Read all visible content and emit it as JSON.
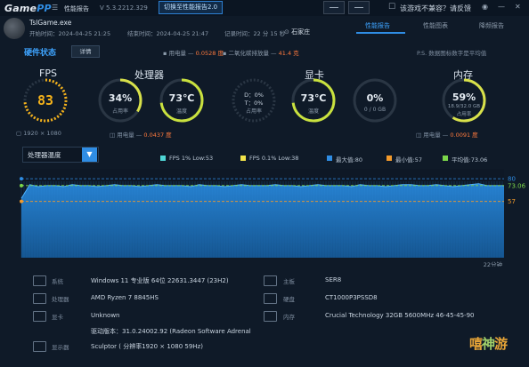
{
  "titlebar": {
    "logo_a": "Game",
    "logo_b": "PP",
    "menu_icon": "menu-icon",
    "report_label": "性能报告",
    "version": "V 5.3.2212.329",
    "switch_label": "切换至性能报告2.0",
    "feedback_label": "该游戏不兼容？请反馈",
    "feedback_icon": "chat-icon"
  },
  "session": {
    "app_name": "TslGame.exe",
    "start_label": "开始时间：",
    "start_time": "2024-04-25 21:25",
    "end_label": "结束时间：",
    "end_time": "2024-04-25 21:47",
    "duration_label": "记录时间：",
    "duration": "22 分 15 秒",
    "location": "石家庄",
    "power_label": "用电量 —",
    "power_value": "0.0528 度",
    "co2_label": "二氧化碳排放量 —",
    "co2_value": "41.4 克"
  },
  "tabs": [
    "性能报告",
    "性能图表",
    "降频报告"
  ],
  "hardware": {
    "title": "硬件状态",
    "detail_btn": "详情",
    "note": "P.S. 数据图标数字是平均值"
  },
  "sections": {
    "fps": {
      "title": "FPS",
      "value": "83",
      "sub": "1920 × 1080",
      "level": 0.75
    },
    "cpu": {
      "title": "处理器",
      "usage_value": "34%",
      "usage_label": "占用率",
      "usage_level": 0.34,
      "temp_value": "73℃",
      "temp_label": "温度",
      "temp_level": 0.73,
      "power_label": "用电量 —",
      "power_value": "0.0437 度"
    },
    "gpu": {
      "title": "显卡",
      "usage_d": "D：0%",
      "usage_t": "T：0%",
      "usage_label": "占用率",
      "temp_value": "73℃",
      "temp_label": "温度",
      "temp_level": 0.73,
      "mem_value": "0%",
      "mem_label": "0 / 0 GB",
      "mem_level": 0.0
    },
    "ram": {
      "title": "内存",
      "usage_value": "59%",
      "usage_sub": "18.9/32.0 GB",
      "usage_label": "占用率",
      "usage_level": 0.59,
      "power_label": "用电量 —",
      "power_value": "0.0091 度"
    }
  },
  "chart_header": {
    "select_value": "处理器温度",
    "legend": [
      {
        "label": "FPS 1% Low:53",
        "color": "#4fd6d6"
      },
      {
        "label": "FPS 0.1% Low:38",
        "color": "#f2e34a"
      },
      {
        "label": "最大值:80",
        "color": "#2f8de4"
      },
      {
        "label": "最小值:57",
        "color": "#f39a2b"
      },
      {
        "label": "平均值:73.06",
        "color": "#7bd64a"
      }
    ]
  },
  "chart_data": {
    "type": "area",
    "title": "",
    "series": [
      {
        "name": "处理器温度",
        "values": [
          60,
          74,
          72,
          73,
          73,
          72,
          74,
          73,
          73,
          72,
          73,
          74,
          73,
          73,
          72,
          73,
          74,
          73,
          73,
          73,
          72,
          74,
          73,
          73,
          72,
          73,
          74,
          73,
          73,
          73,
          74,
          73,
          73,
          72,
          73,
          74,
          73,
          73,
          73,
          72,
          74,
          73,
          73,
          72,
          73,
          74,
          74,
          73,
          73,
          74,
          73,
          72,
          73,
          74,
          75,
          73,
          73,
          73
        ]
      }
    ],
    "ylim": [
      0,
      90
    ],
    "ref_lines": [
      {
        "name": "最大值",
        "value": 80,
        "label": "80"
      },
      {
        "name": "平均值",
        "value": 73.06,
        "label": "73.06"
      },
      {
        "name": "最小值",
        "value": 57,
        "label": "57"
      }
    ],
    "x_end_label": "22分钟"
  },
  "system_info": [
    {
      "icon": "windows-icon",
      "key": "系统",
      "value": "Windows 11 专业版 64位 22631.3447 (23H2)"
    },
    {
      "icon": "cpu-icon",
      "key": "处理器",
      "value": "AMD Ryzen 7 8845HS"
    },
    {
      "icon": "gpu-icon",
      "key": "显卡",
      "value": "Unknown"
    },
    {
      "icon": "driver-icon",
      "key": "",
      "value": "驱动版本：31.0.24002.92 (Radeon Software Adrenal"
    },
    {
      "icon": "monitor-icon",
      "key": "显示器",
      "value": "Sculptor ( 分辨率1920 × 1080 59Hz)"
    }
  ],
  "system_info_right": [
    {
      "icon": "motherboard-icon",
      "key": "主板",
      "value": "SER8"
    },
    {
      "icon": "disk-icon",
      "key": "硬盘",
      "value": "CT1000P3PSSD8"
    },
    {
      "icon": "ram-icon",
      "key": "内存",
      "value": "Crucial Technology 32GB 5600MHz 46-45-45-90"
    }
  ],
  "watermark": {
    "a": "嘻",
    "b": "神",
    "c": "游"
  }
}
